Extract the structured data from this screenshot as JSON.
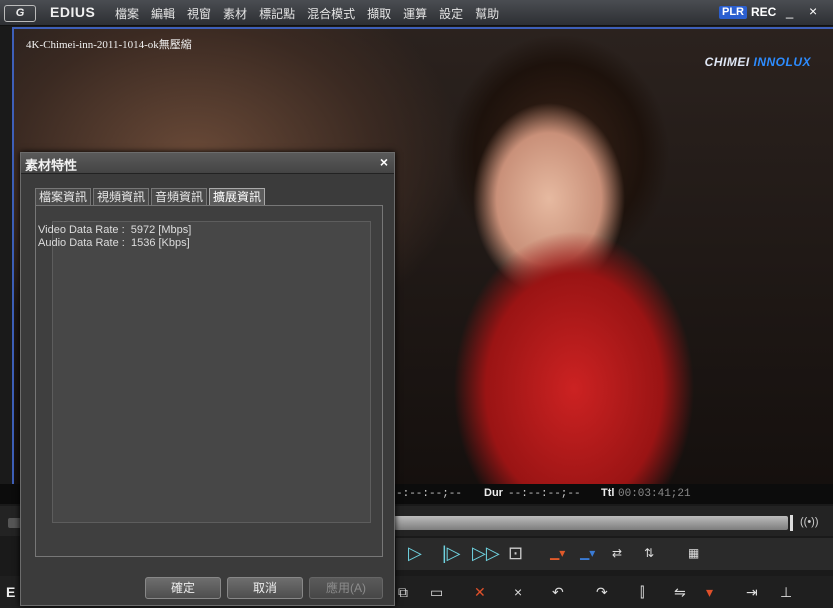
{
  "app": {
    "logo_text": "G",
    "name": "EDIUS",
    "menu": [
      "檔案",
      "編輯",
      "視窗",
      "素材",
      "標記點",
      "混合模式",
      "擷取",
      "運算",
      "設定",
      "幫助"
    ],
    "plr": "PLR",
    "rec": "REC",
    "minimize": "_",
    "close": "×"
  },
  "player": {
    "clip_name": "4K-Chimei-inn-2011-1014-ok無壓縮",
    "watermark_a": "CHIMEI",
    "watermark_b": "INNOLUX",
    "tc_in": "-:--:--;--",
    "dur_label": "Dur",
    "dur_value": "--:--:--;--",
    "ttl_label": "Ttl",
    "ttl_value": "00:03:41;21",
    "audio_icon": "((•))"
  },
  "dialog": {
    "title": "素材特性",
    "close": "×",
    "tabs": [
      "檔案資訊",
      "視頻資訊",
      "音頻資訊",
      "擴展資訊"
    ],
    "active_tab": 3,
    "info": {
      "video_label": "Video Data Rate :",
      "video_value": "5972 [Mbps]",
      "audio_label": "Audio Data Rate :",
      "audio_value": "1536 [Kbps]"
    },
    "buttons": {
      "ok": "確定",
      "cancel": "取消",
      "apply": "應用(A)"
    }
  },
  "transport": {
    "play": "▷",
    "frame_forward": "|▷",
    "fast_forward": "▷▷",
    "loop": "⊡"
  },
  "colors": {
    "accent_blue": "#3e5fb8",
    "transport_cyan": "#6fd3e0",
    "plr_blue": "#2b5fd0"
  }
}
